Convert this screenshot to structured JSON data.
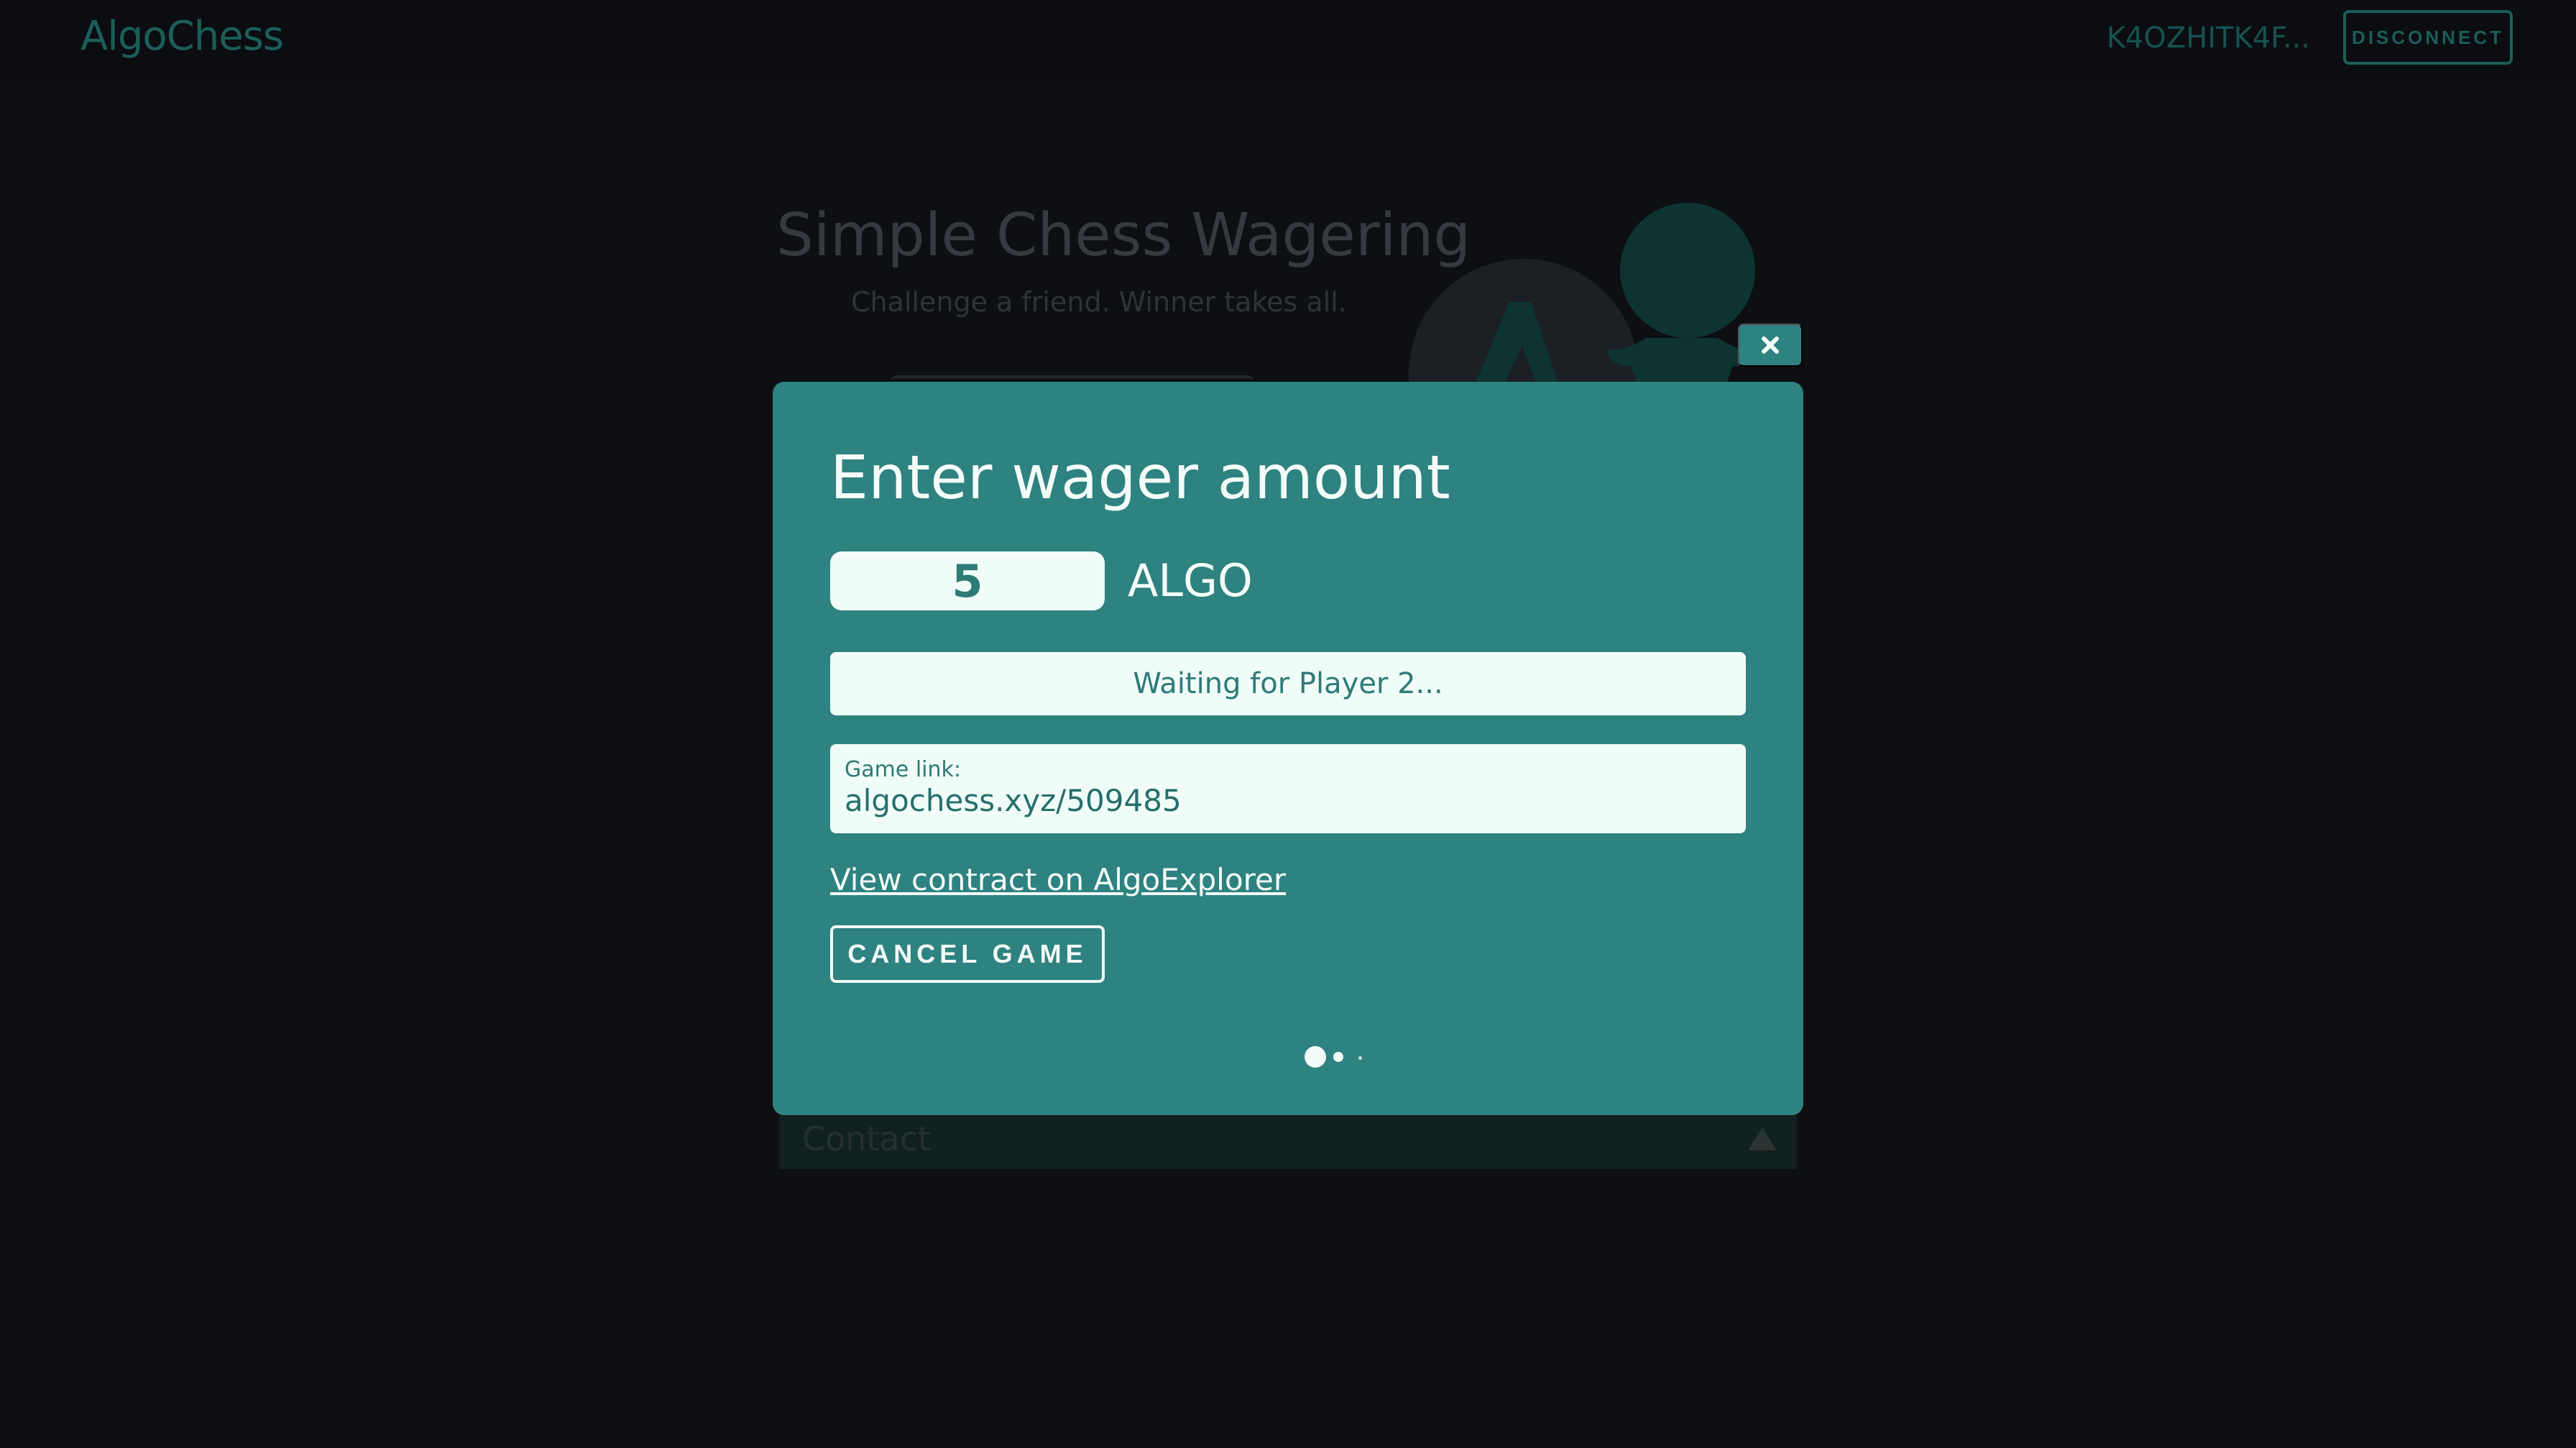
{
  "header": {
    "logo": "AlgoChess",
    "wallet_address": "K4OZHITK4F...",
    "disconnect_label": "DISCONNECT"
  },
  "hero": {
    "title": "Simple Chess Wagering",
    "subtitle": "Challenge a friend. Winner takes all."
  },
  "contact": {
    "label": "Contact"
  },
  "modal": {
    "title": "Enter wager amount",
    "wager_value": "5",
    "unit": "ALGO",
    "status": "Waiting for Player 2...",
    "game_link_label": "Game link:",
    "game_link_value": "algochess.xyz/509485",
    "explorer_link": "View contract on AlgoExplorer",
    "cancel_label": "CANCEL GAME",
    "close_icon": "close-icon",
    "loading_icon": "loading-dots-icon"
  },
  "colors": {
    "background": "#0d0f13",
    "modal": "#2e8280",
    "accent_dim": "#1b5e59",
    "light": "#f0fcf8"
  }
}
